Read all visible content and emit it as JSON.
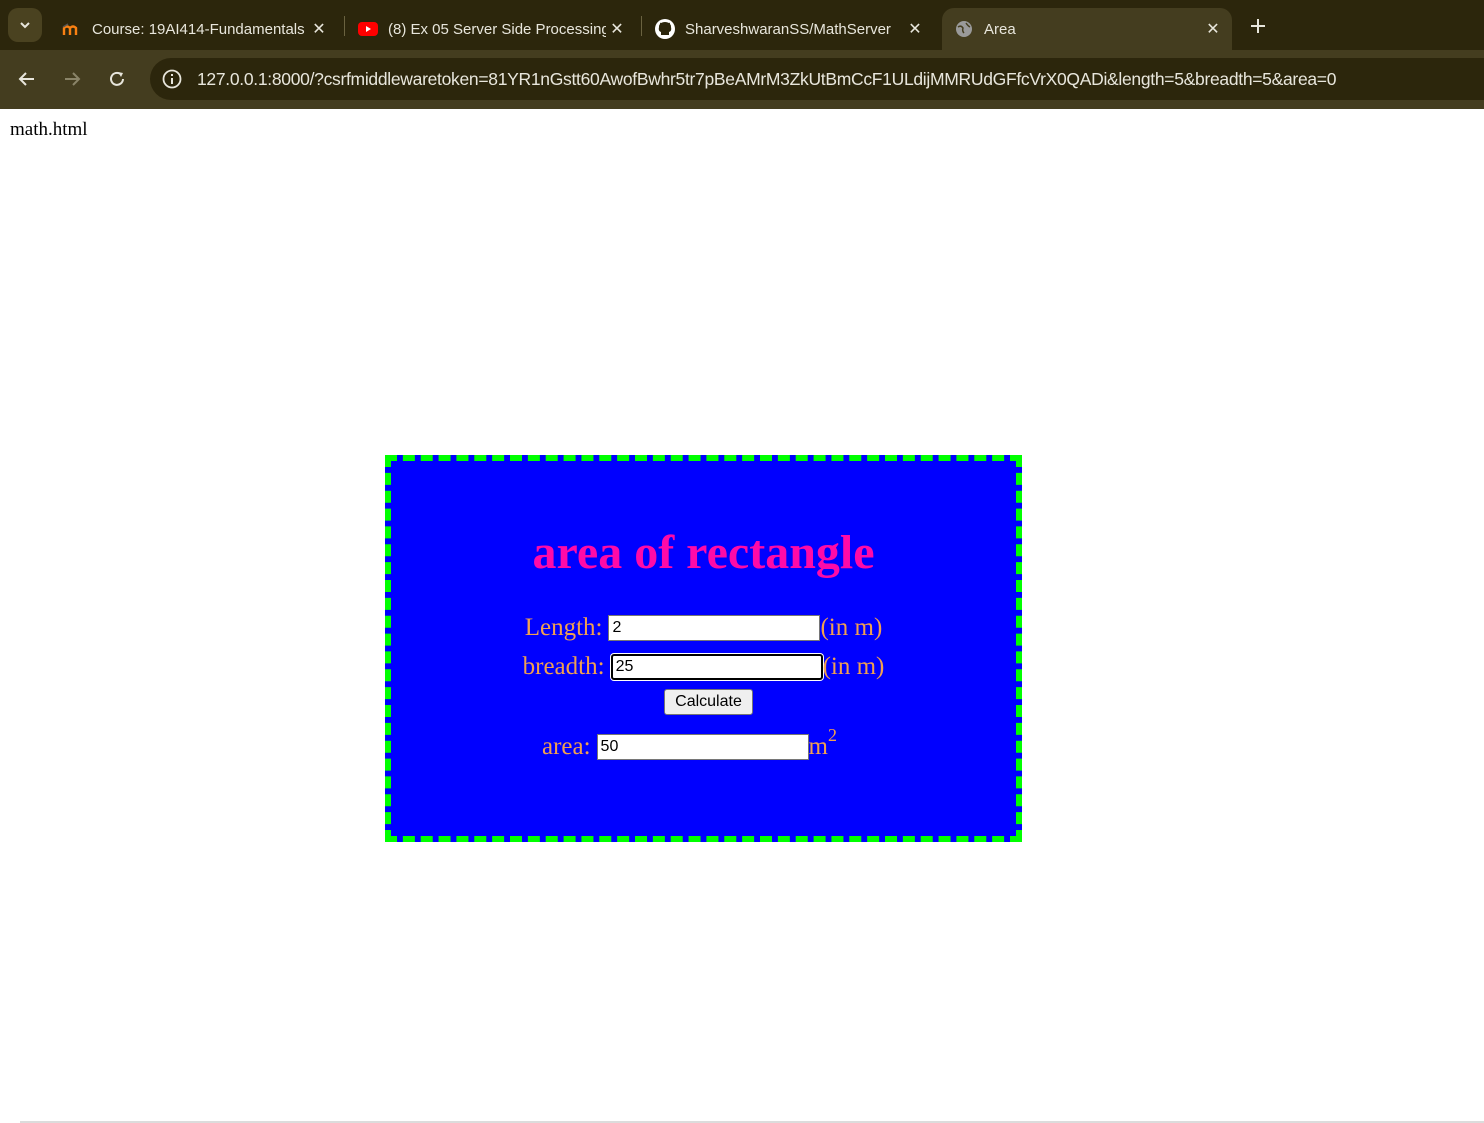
{
  "browser": {
    "tabs": [
      {
        "title": "Course: 19AI414-Fundamentals",
        "icon": "moodle-icon"
      },
      {
        "title": "(8) Ex 05 Server Side Processing",
        "icon": "youtube-icon"
      },
      {
        "title": "SharveshwaranSS/MathServer",
        "icon": "github-icon"
      },
      {
        "title": "Area",
        "icon": "globe-icon",
        "active": true
      }
    ],
    "url": "127.0.0.1:8000/?csrfmiddlewaretoken=81YR1nGstt60AwofBwhr5tr7pBeAMrM3ZkUtBmCcF1ULdijMMRUdGFfcVrX0QADi&length=5&breadth=5&area=0"
  },
  "page": {
    "filename_label": "math.html",
    "title": "area of rectangle",
    "length": {
      "label": "Length:",
      "value": "2",
      "unit": "(in m)"
    },
    "breadth": {
      "label": "breadth:",
      "value": "25",
      "unit": "(in m)"
    },
    "calculate_label": "Calculate",
    "area": {
      "label": "area:",
      "value": "50",
      "unit": "m",
      "unit_sup": "2"
    }
  },
  "colors": {
    "card_bg": "#0000ff",
    "card_border": "#00ff00",
    "title": "#ff0aa8",
    "labels": "#f0a050"
  }
}
